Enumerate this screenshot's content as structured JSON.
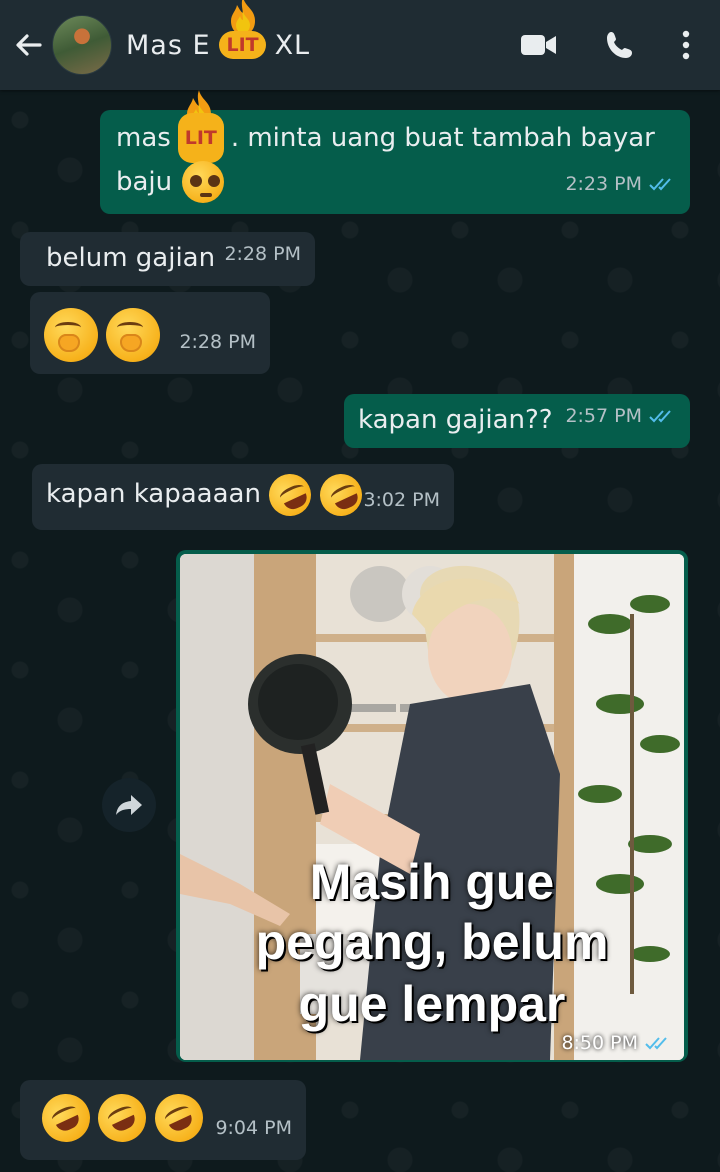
{
  "header": {
    "contact_name_prefix": "Mas E",
    "contact_name_suffix": "XL",
    "sticker_text": "LIT"
  },
  "messages": [
    {
      "direction": "out",
      "text_prefix": "mas",
      "text_suffix": ". minta uang buat tambah bayar",
      "text_line2": "baju",
      "time": "2:23 PM",
      "status": "read"
    },
    {
      "direction": "in",
      "text": "belum gajian",
      "time": "2:28 PM"
    },
    {
      "direction": "in",
      "text": "",
      "time": "2:28 PM"
    },
    {
      "direction": "out",
      "text": "kapan gajian??",
      "time": "2:57 PM",
      "status": "read"
    },
    {
      "direction": "in",
      "text": "kapan kapaaaan",
      "time": "3:02 PM"
    },
    {
      "direction": "out",
      "type": "image",
      "caption_lines": [
        "Masih gue",
        "pegang, belum",
        "gue lempar"
      ],
      "time": "8:50 PM",
      "status": "read"
    },
    {
      "direction": "in",
      "text": "",
      "time": "9:04 PM"
    }
  ],
  "colors": {
    "header_bg": "#1f2c33",
    "outgoing_bubble": "#055d4b",
    "incoming_bubble": "#202c33",
    "read_ticks": "#53bdeb"
  }
}
